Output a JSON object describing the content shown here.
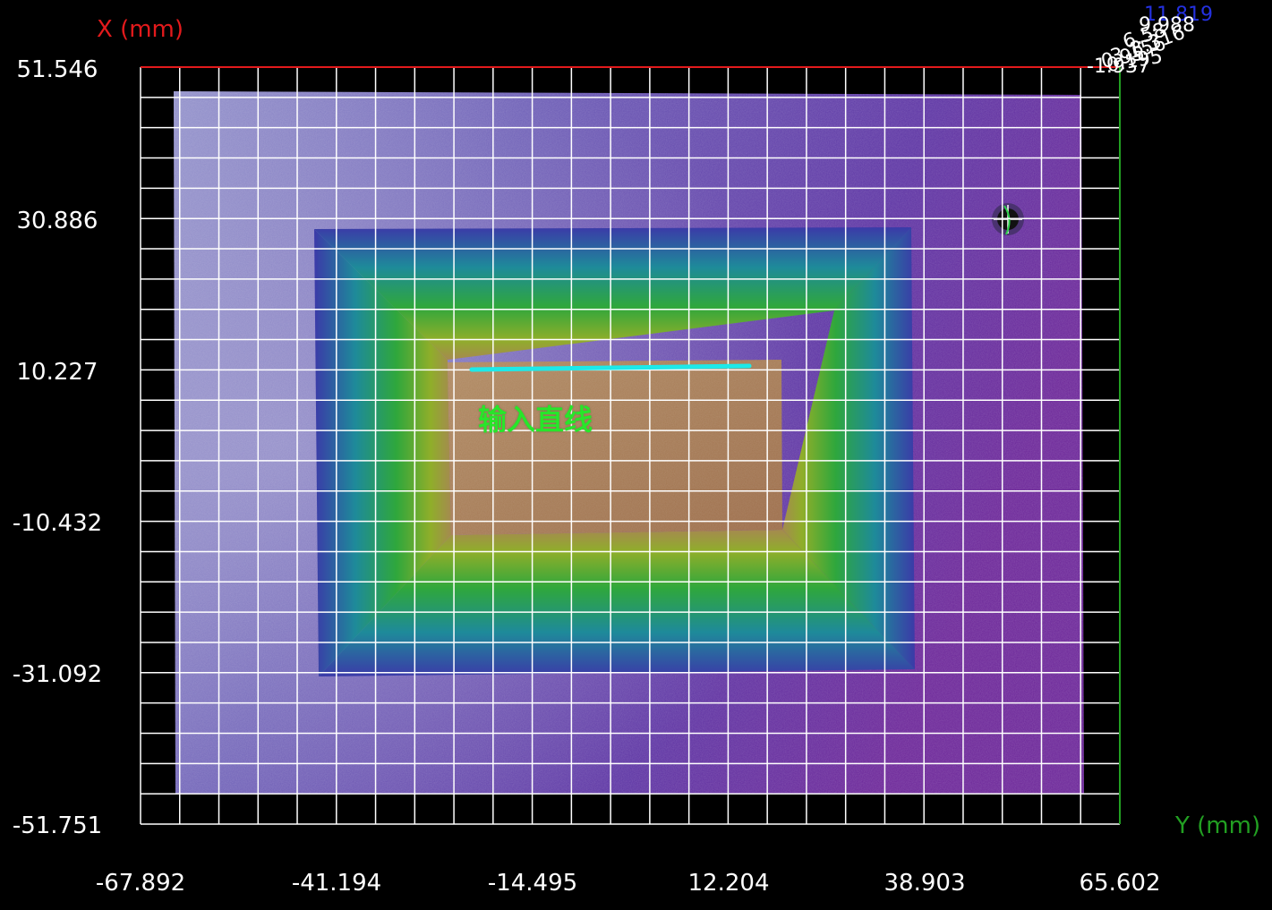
{
  "axes": {
    "x_axis_title": "X (mm)",
    "y_axis_title": "Y (mm)",
    "vertical_tick_labels": [
      "51.546",
      "30.886",
      "10.227",
      "-10.432",
      "-31.092",
      "-51.751"
    ],
    "horizontal_tick_labels": [
      "-67.892",
      "-41.194",
      "-14.495",
      "12.204",
      "38.903",
      "65.602"
    ]
  },
  "height_scale": {
    "labels": [
      "11.819",
      "9.988",
      "6.58",
      "3.316",
      "3.156",
      "0.95",
      "0.195",
      "-1.937"
    ]
  },
  "annotation": {
    "label": "输入直线",
    "line_color": "#1de9e9",
    "text_color": "#27e62a"
  },
  "colors": {
    "background": "#000000",
    "grid": "#ffffff",
    "x_axis": "#e31a1c",
    "y_axis": "#22a022"
  }
}
